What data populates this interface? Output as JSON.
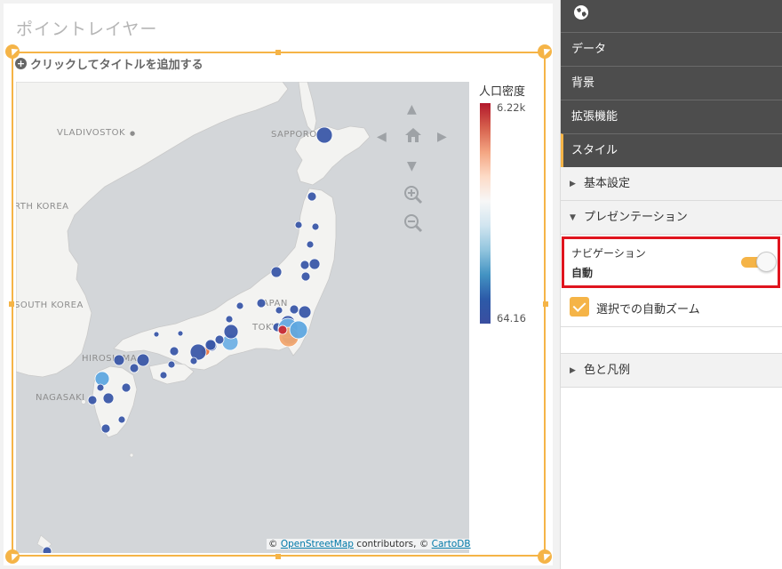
{
  "sheet": {
    "title": "ポイントレイヤー",
    "add_title": "クリックしてタイトルを追加する"
  },
  "map": {
    "cities": [
      "VLADIVOSTOK",
      "SAPPORO",
      "RTH KOREA",
      "SOUTH KOREA",
      "HIROSHIMA",
      "NAGASAKI",
      "TOKYO",
      "JAPAN"
    ],
    "attribution": {
      "prefix": "© ",
      "osm": "OpenStreetMap",
      "middle": " contributors, © ",
      "carto": "CartoDB"
    }
  },
  "legend": {
    "title": "人口密度",
    "max": "6.22k",
    "min": "64.16"
  },
  "colors": {
    "accent": "#f5b447",
    "highlight": "#e0141e",
    "panel_dark": "#4d4d4d",
    "low": "#3a57a8",
    "high": "#b2182b"
  },
  "panel": {
    "top_icon": "globe-icon",
    "items": [
      {
        "label": "データ"
      },
      {
        "label": "背景"
      },
      {
        "label": "拡張機能"
      },
      {
        "label": "スタイル"
      }
    ],
    "sections": {
      "basic": "基本設定",
      "presentation": "プレゼンテーション",
      "color_legend": "色と凡例"
    },
    "navigation": {
      "label": "ナビゲーション",
      "value": "自動",
      "toggle_on": true
    },
    "auto_zoom": {
      "label": "選択での自動ズーム",
      "checked": true
    }
  }
}
